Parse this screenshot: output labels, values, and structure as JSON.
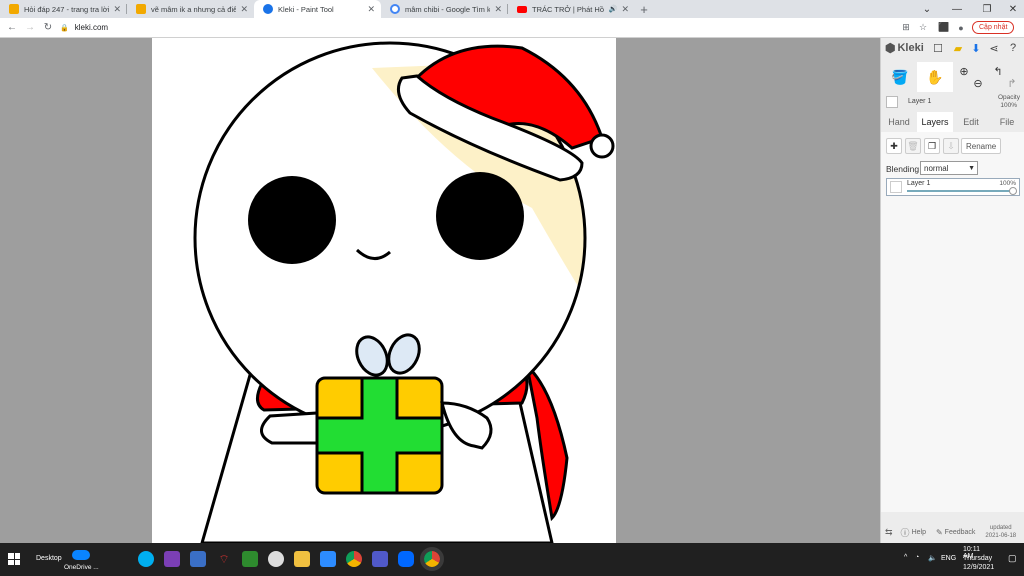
{
  "browser": {
    "tabs": [
      {
        "title": "Hỏi đáp 247 - trang tra lời",
        "icon_color": "#f2a900"
      },
      {
        "title": "vẽ mâm ik a nhưng cả điểm đè",
        "icon_color": "#f2a900"
      },
      {
        "title": "Kleki - Paint Tool",
        "icon_color": "#1a73e8"
      },
      {
        "title": "mâm chibi - Google Tìm kiếm",
        "icon_color": "#4285f4"
      },
      {
        "title": "TRÁC TRỞ | Phát Hồ x JokeS",
        "icon_color": "#ff0000"
      }
    ],
    "new_tab": "+",
    "url": "kleki.com",
    "update_label": "Cập nhật"
  },
  "kleki": {
    "logo": "Kleki",
    "layer_preview_name": "Layer 1",
    "opacity_label": "Opacity",
    "opacity_value": "100%",
    "tabs": [
      "Hand",
      "Layers",
      "Edit",
      "File"
    ],
    "active_tab": "Layers",
    "rename_label": "Rename",
    "blending_label": "Blending",
    "blending_value": "normal",
    "layer_name": "Layer 1",
    "layer_opacity": "100%",
    "help_label": "Help",
    "feedback_label": "Feedback",
    "updated_label": "updated",
    "updated_date": "2021-06-18"
  },
  "taskbar": {
    "desktop_label": "Desktop",
    "onedrive_label": "OneDrive ...",
    "lang": "ENG",
    "time": "10:11 AM",
    "day": "Thursday",
    "date": "12/9/2021"
  },
  "colors": {
    "hat_red": "#ff0000",
    "gift_yellow": "#ffcc00",
    "gift_green": "#22dd33",
    "hair_cream": "#fdf1c8",
    "bow_blue": "#dde9f5"
  }
}
